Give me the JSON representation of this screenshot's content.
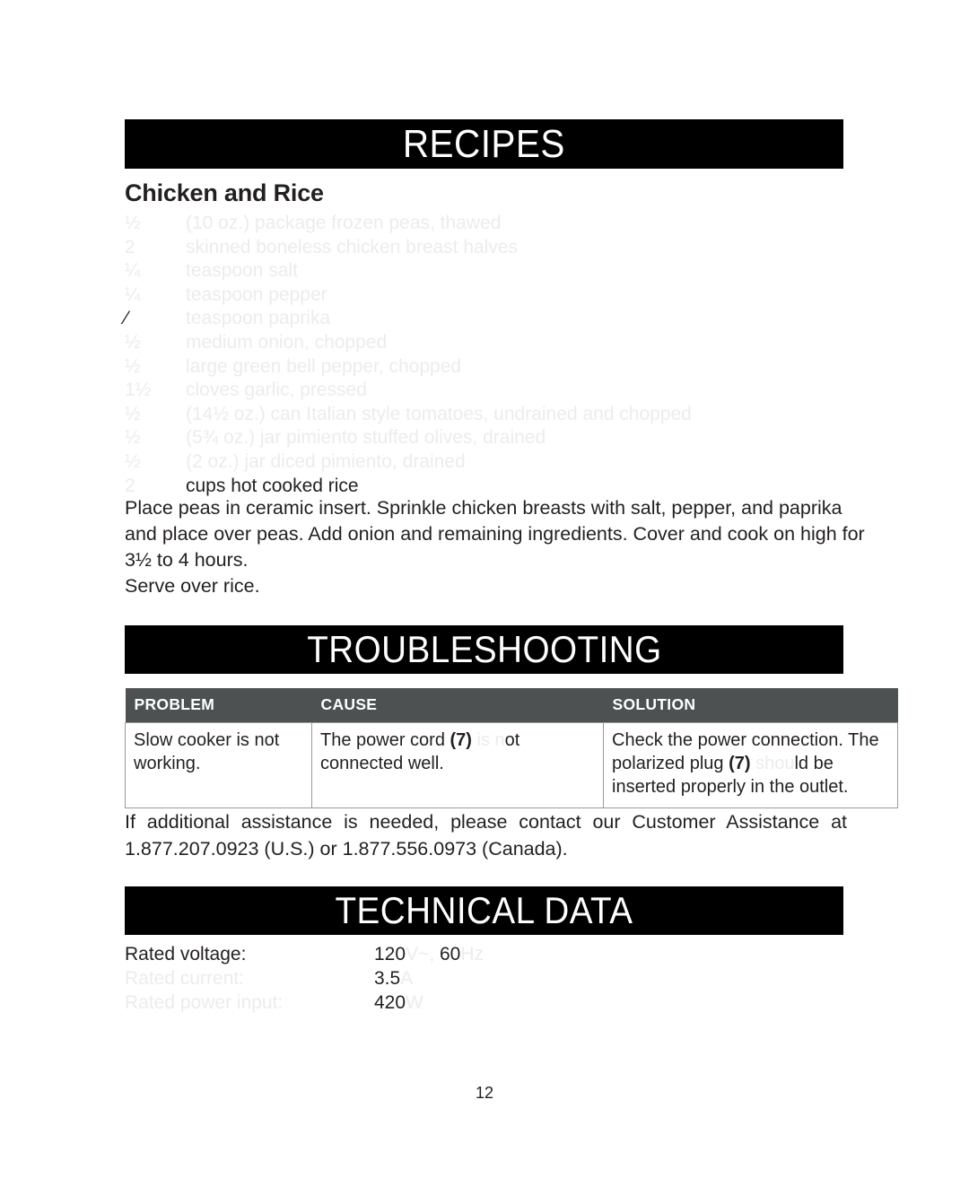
{
  "page": {
    "number": "12"
  },
  "sections": {
    "recipes": {
      "banner": "RECIPES",
      "recipe_title": "Chicken and Rice",
      "ingredients": [
        {
          "qty": "½",
          "desc": "(10 oz.) package frozen peas, thawed",
          "qty_style": "faint",
          "desc_style": "faint"
        },
        {
          "qty": "2",
          "desc": "skinned boneless chicken breast halves",
          "qty_style": "faint",
          "desc_style": "faint"
        },
        {
          "qty": "¼",
          "desc": "teaspoon salt",
          "qty_style": "faint",
          "desc_style": "faint"
        },
        {
          "qty": "¼",
          "desc": "teaspoon pepper",
          "qty_style": "faint",
          "desc_style": "faint"
        },
        {
          "qty": "⁄",
          "desc": "teaspoon paprika",
          "qty_style": "dark",
          "desc_style": "faint"
        },
        {
          "qty": "½",
          "desc": "medium onion, chopped",
          "qty_style": "faint",
          "desc_style": "faint"
        },
        {
          "qty": "½",
          "desc": "large green bell pepper, chopped",
          "qty_style": "faint",
          "desc_style": "faint"
        },
        {
          "qty": "1½",
          "desc": "cloves garlic, pressed",
          "qty_style": "faint",
          "desc_style": "faint"
        },
        {
          "qty": "½",
          "desc": "(14½ oz.) can Italian style tomatoes, undrained and chopped",
          "qty_style": "faint",
          "desc_style": "faint"
        },
        {
          "qty": "½",
          "desc": "(5¾ oz.) jar pimiento stuffed olives, drained",
          "qty_style": "faint",
          "desc_style": "faint"
        },
        {
          "qty": "½",
          "desc": "(2 oz.) jar diced pimiento, drained",
          "qty_style": "faint",
          "desc_style": "faint"
        },
        {
          "qty": "2",
          "desc": "cups hot cooked rice",
          "qty_style": "faint",
          "desc_style": "dark"
        }
      ],
      "method_lines": [
        "Place peas in ceramic insert. Sprinkle chicken breasts with salt, pepper, and paprika",
        "and place over peas. Add onion and remaining ingredients. Cover and cook on high for",
        "3½ to 4 hours.",
        "Serve over rice."
      ]
    },
    "troubleshooting": {
      "banner": "TROUBLESHOOTING",
      "columns": [
        "PROBLEM",
        "CAUSE",
        "SOLUTION"
      ],
      "rows": [
        {
          "problem": "Slow cooker is not working.",
          "cause_pre": "The power cord ",
          "cause_ref": "(7)",
          "cause_faded": " is n",
          "cause_post": "ot connected well.",
          "solution_pre": "Check the power connection. The polarized plug ",
          "solution_ref": "(7)",
          "solution_faded": " shou",
          "solution_post": "ld be inserted properly in the outlet."
        }
      ],
      "assistance_line1": "If additional assistance is needed, please contact our Customer Assistance at",
      "assistance_line2": "1.877.207.0923 (U.S.) or 1.877.556.0973 (Canada)."
    },
    "technical": {
      "banner": "TECHNICAL DATA",
      "rows": [
        {
          "label": "Rated voltage:",
          "label_style": "dark",
          "value_dark": "120",
          "value_faded": "V~, ",
          "value_dark2": "60",
          "value_faded2": "Hz"
        },
        {
          "label": "Rated current:",
          "label_style": "faint",
          "value_dark": "3.5",
          "value_faded": "A",
          "value_dark2": "",
          "value_faded2": ""
        },
        {
          "label": "Rated power input:",
          "label_style": "faint",
          "value_dark": "420",
          "value_faded": "W",
          "value_dark2": "",
          "value_faded2": ""
        }
      ]
    }
  },
  "colors": {
    "banner_bg": "#000000",
    "banner_text": "#ffffff",
    "table_header_bg": "#4d5152",
    "table_border": "#9a9a9a",
    "body_text": "#231f20",
    "faded_text": "#ececec"
  }
}
